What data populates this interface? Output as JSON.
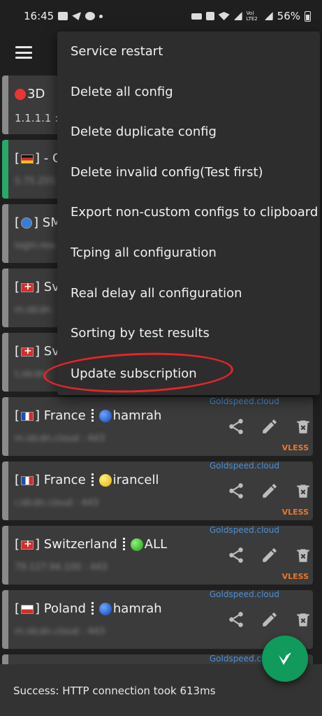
{
  "status_bar": {
    "time": "16:45",
    "battery_percent": "56%",
    "network_label": "Vo) LTE2"
  },
  "menu": {
    "items": [
      "Service restart",
      "Delete all config",
      "Delete duplicate config",
      "Delete invalid config(Test first)",
      "Export non-custom configs to clipboard",
      "Tcping all configuration",
      "Real delay all configuration",
      "Sorting by test results",
      "Update subscription"
    ]
  },
  "configs": [
    {
      "title": "3D",
      "address": "1.1.1.1 :",
      "bar": "gray"
    },
    {
      "title": "- G",
      "address": "5.75.255.",
      "bar": "green"
    },
    {
      "title": "SM",
      "address": "login.rea.",
      "bar": "gray"
    },
    {
      "title": "Sv",
      "address": "m.idcdn.",
      "bar": "gray"
    },
    {
      "title": "Sv",
      "address": "t.idcdn.",
      "bar": "gray"
    },
    {
      "country": "France",
      "operator": "hamrah",
      "address": "m.idcdn.cloud : 443",
      "brand": "Goldspeed.cloud",
      "protocol": "VLESS"
    },
    {
      "country": "France",
      "operator": "irancell",
      "address": "i.idcdn.cloud : 443",
      "brand": "Goldspeed.cloud",
      "protocol": "VLESS"
    },
    {
      "country": "Switzerland",
      "operator": "ALL",
      "address": "79.127.94.100 : 443",
      "brand": "Goldspeed.cloud",
      "protocol": "VLESS"
    },
    {
      "country": "Poland",
      "operator": "hamrah",
      "address": "m.idcdn.cloud : 443",
      "brand": "Goldspeed.cloud",
      "protocol": "VLESS"
    },
    {
      "brand": "Goldspeed.cloud"
    }
  ],
  "snackbar": {
    "message": "Success: HTTP connection took 613ms"
  },
  "colors": {
    "accent_green": "#109a5c",
    "brand_blue": "#4b8fd6",
    "protocol_orange": "#e8772e",
    "annotation_red": "#e8232b"
  },
  "icons": {
    "share": "share-icon",
    "edit": "pencil-icon",
    "delete": "delete-icon",
    "fab": "v-logo-icon"
  }
}
